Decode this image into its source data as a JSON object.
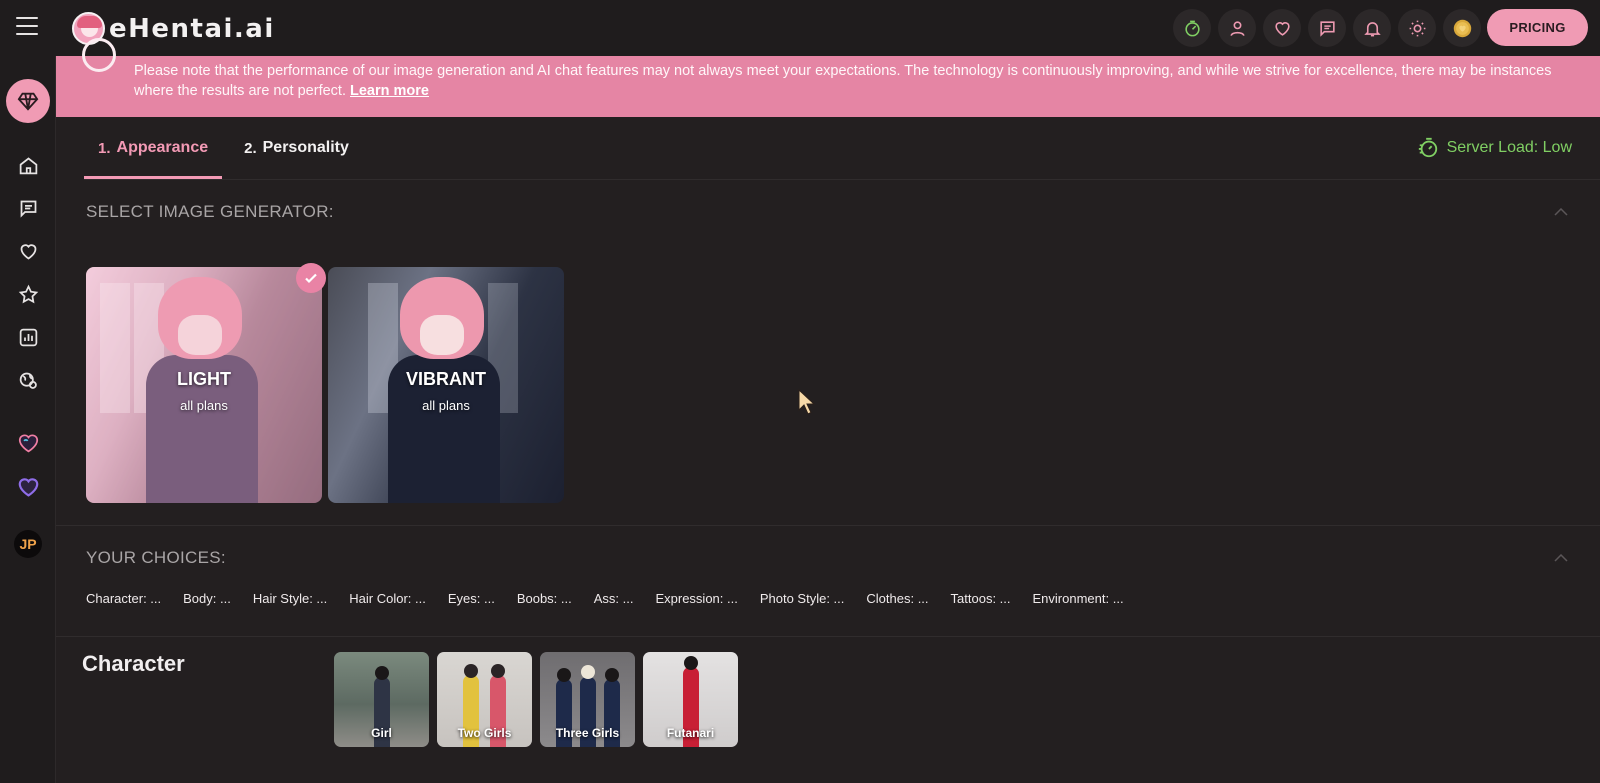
{
  "header": {
    "logo_text": "eHentai.ai",
    "pricing_label": "PRICING",
    "icons": [
      "speedometer-icon",
      "user-icon",
      "heart-icon",
      "chat-icon",
      "bell-icon",
      "sun-icon",
      "coin-icon"
    ]
  },
  "sidebar": {
    "items": [
      "gem-icon",
      "home-icon",
      "chat-icon",
      "heart-icon",
      "star-icon",
      "chart-icon",
      "settings-icon",
      "heart-app-icon",
      "heart-outline-app-icon",
      "avatar"
    ],
    "avatar_initials": "JP"
  },
  "notice": {
    "text": "Please note that the performance of our image generation and AI chat features may not always meet your expectations. The technology is continuously improving, and while we strive for excellence, there may be instances where the results are not perfect.",
    "link_label": "Learn more"
  },
  "tabs": [
    {
      "num": "1.",
      "label": "Appearance",
      "active": true
    },
    {
      "num": "2.",
      "label": "Personality",
      "active": false
    }
  ],
  "server_load": "Server Load: Low",
  "image_generator": {
    "heading": "SELECT IMAGE GENERATOR:",
    "options": [
      {
        "label": "LIGHT",
        "sub": "all plans",
        "selected": true
      },
      {
        "label": "VIBRANT",
        "sub": "all plans",
        "selected": false
      }
    ]
  },
  "choices": {
    "heading": "YOUR CHOICES:",
    "items": [
      "Character: ...",
      "Body: ...",
      "Hair Style: ...",
      "Hair Color: ...",
      "Eyes: ...",
      "Boobs: ...",
      "Ass: ...",
      "Expression: ...",
      "Photo Style: ...",
      "Clothes: ...",
      "Tattoos: ...",
      "Environment: ..."
    ]
  },
  "character": {
    "heading": "Character",
    "options": [
      "Girl",
      "Two Girls",
      "Three Girls",
      "Futanari"
    ]
  },
  "colors": {
    "accent_pink": "#f09bb4",
    "notice_bg": "#e585a4",
    "server_green": "#80cf63",
    "background": "#221f20"
  }
}
